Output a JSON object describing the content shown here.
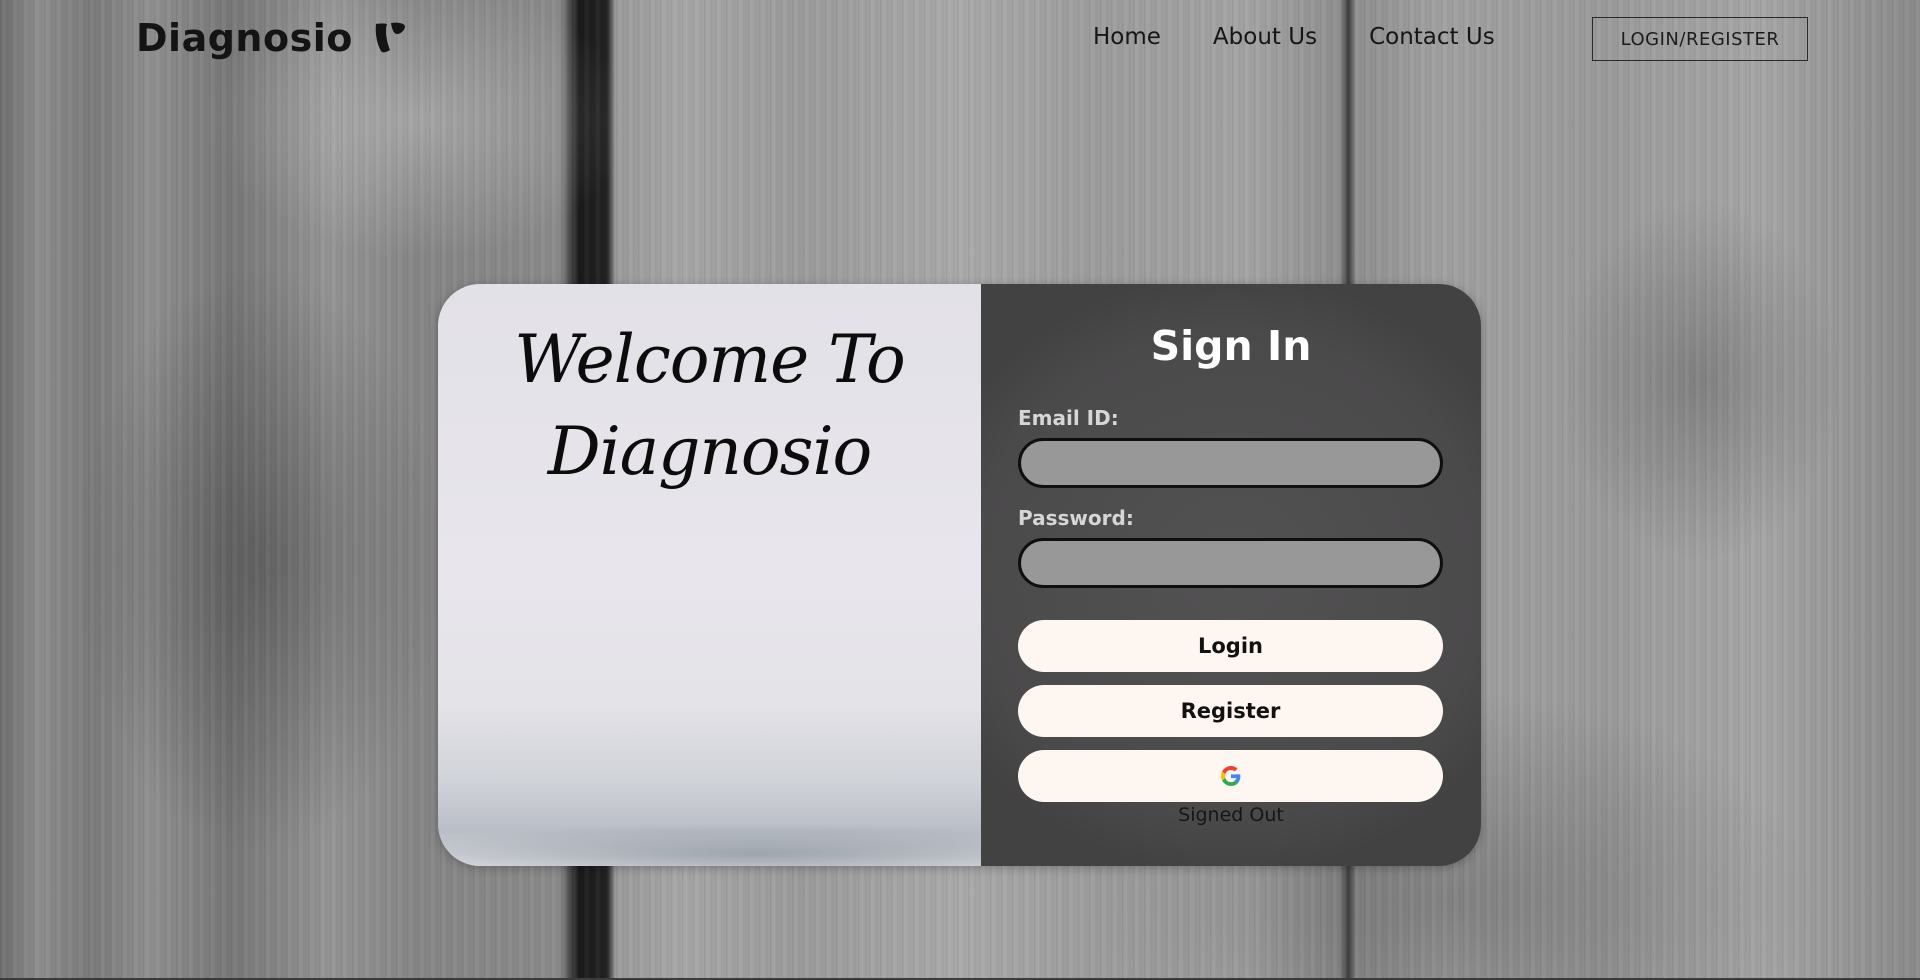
{
  "header": {
    "brand_name": "Diagnosio",
    "brand_icon": "typo3-logo-icon",
    "nav": {
      "home": "Home",
      "about": "About Us",
      "contact": "Contact Us"
    },
    "login_register": "LOGIN/REGISTER"
  },
  "card": {
    "welcome": {
      "line1": "Welcome To",
      "line2": "Diagnosio"
    },
    "signin": {
      "title": "Sign In",
      "email_label": "Email ID:",
      "email_value": "",
      "password_label": "Password:",
      "password_value": "",
      "login_button": "Login",
      "register_button": "Register",
      "google_button_icon": "google-icon",
      "status": "Signed Out"
    }
  },
  "colors": {
    "signin_panel": "#4b4a4b",
    "input_bg": "#989898",
    "button_bg": "#fdf6f1",
    "welcome_panel": "#e6e4ea"
  }
}
